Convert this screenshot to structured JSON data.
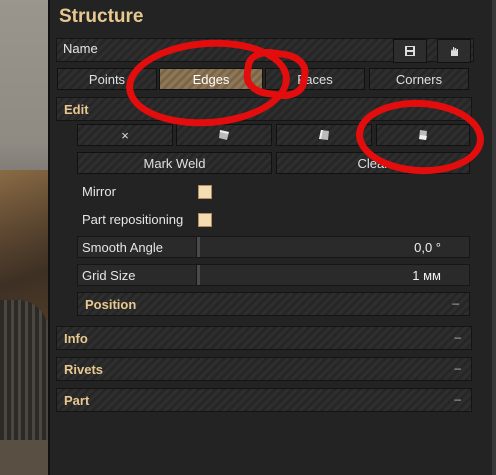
{
  "panel": {
    "title": "Structure"
  },
  "name_row": {
    "label": "Name",
    "save_icon": "save-icon",
    "hand_icon": "hand-icon"
  },
  "tabs": [
    {
      "label": "Points",
      "active": false
    },
    {
      "label": "Edges",
      "active": true
    },
    {
      "label": "Faces",
      "active": false
    },
    {
      "label": "Corners",
      "active": false
    }
  ],
  "edit": {
    "header": "Edit",
    "toggle": "–",
    "tools": [
      {
        "glyph": "×",
        "icon": "close-icon"
      },
      {
        "glyph": "",
        "icon": "plate-icon-1"
      },
      {
        "glyph": "",
        "icon": "plate-icon-2"
      },
      {
        "glyph": "",
        "icon": "plate-icon-3"
      }
    ],
    "mark_weld": "Mark Weld",
    "clear": "Clear",
    "mirror": "Mirror",
    "part_repositioning": "Part repositioning",
    "smooth_angle": {
      "label": "Smooth Angle",
      "value": "0,0 °"
    },
    "grid_size": {
      "label": "Grid Size",
      "value": "1 мм"
    }
  },
  "sections": {
    "position": {
      "label": "Position",
      "toggle": "–"
    },
    "info": {
      "label": "Info",
      "toggle": "–"
    },
    "rivets": {
      "label": "Rivets",
      "toggle": "–"
    },
    "part": {
      "label": "Part",
      "toggle": "–"
    }
  },
  "colors": {
    "accent": "#e8c890",
    "annotation": "#e30d0d"
  }
}
